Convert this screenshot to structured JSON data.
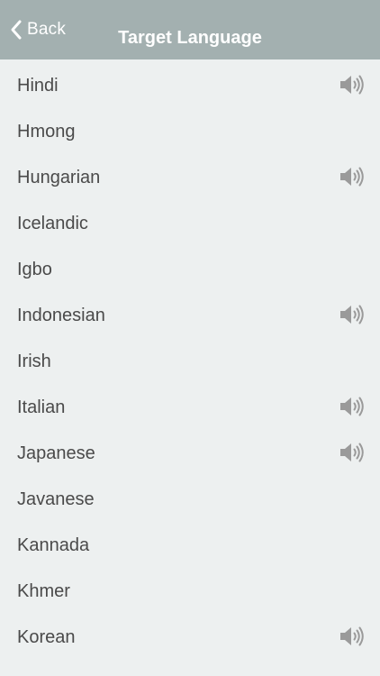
{
  "nav": {
    "back_label": "Back",
    "title": "Target Language"
  },
  "languages": [
    {
      "label": "Hindi",
      "audio": true
    },
    {
      "label": "Hmong",
      "audio": false
    },
    {
      "label": "Hungarian",
      "audio": true
    },
    {
      "label": "Icelandic",
      "audio": false
    },
    {
      "label": "Igbo",
      "audio": false
    },
    {
      "label": "Indonesian",
      "audio": true
    },
    {
      "label": "Irish",
      "audio": false
    },
    {
      "label": "Italian",
      "audio": true
    },
    {
      "label": "Japanese",
      "audio": true
    },
    {
      "label": "Javanese",
      "audio": false
    },
    {
      "label": "Kannada",
      "audio": false
    },
    {
      "label": "Khmer",
      "audio": false
    },
    {
      "label": "Korean",
      "audio": true
    }
  ],
  "icons": {
    "back": "chevron-left-icon",
    "audio": "speaker-icon"
  },
  "colors": {
    "nav_bar": "#a3b0b0",
    "background": "#edf0f0",
    "text": "#4a4a4a",
    "icon": "#9a9a9a"
  }
}
